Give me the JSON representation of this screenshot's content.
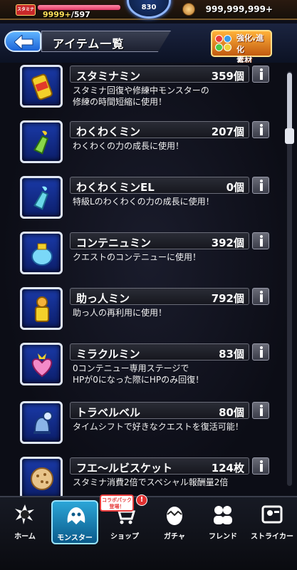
{
  "status": {
    "stamina_label": "スタミナ",
    "stamina_current": "9999+",
    "stamina_max": "/597",
    "stamina_fraction": 1.0,
    "rank": "830",
    "coins": "999,999,999+"
  },
  "header": {
    "title": "アイテム一覧",
    "evolve_button_line1": "強化",
    "evolve_button_v": "v",
    "evolve_button_line1b": "進化",
    "evolve_button_line2": "素材"
  },
  "items": [
    {
      "name": "スタミナミン",
      "count": "359個",
      "desc": "スタミナ回復や修練中モンスターの\n修練の時間短縮に使用！",
      "icon": "stamina-can-icon"
    },
    {
      "name": "わくわくミン",
      "count": "207個",
      "desc": "わくわくの力の成長に使用！",
      "icon": "waku-bottle-icon"
    },
    {
      "name": "わくわくミンEL",
      "count": "0個",
      "desc": "特級Lのわくわくの力の成長に使用！",
      "icon": "waku-el-bottle-icon"
    },
    {
      "name": "コンテニュミン",
      "count": "392個",
      "desc": "クエストのコンテニューに使用！",
      "icon": "continue-jar-icon"
    },
    {
      "name": "助っ人ミン",
      "count": "792個",
      "desc": "助っ人の再利用に使用！",
      "icon": "helper-figure-icon"
    },
    {
      "name": "ミラクルミン",
      "count": "83個",
      "desc": "0コンテニュー専用ステージで\nHPが0になった際にHPのみ回復！",
      "icon": "miracle-heart-icon"
    },
    {
      "name": "トラベルベル",
      "count": "80個",
      "desc": "タイムシフトで好きなクエストを復活可能！",
      "icon": "travel-bell-icon"
    },
    {
      "name": "フエ〜ルビスケット",
      "count": "124枚",
      "desc": "スタミナ消費2倍でスペシャル報酬量2倍",
      "icon": "biscuit-icon"
    }
  ],
  "nav": {
    "home": "ホーム",
    "monster": "モンスター",
    "shop": "ショップ",
    "gacha": "ガチャ",
    "friend": "フレンド",
    "striker": "ストライカー",
    "shop_badge": "コラボパック\n登場！",
    "alert": "!"
  },
  "colors": {
    "accent_blue": "#1c64d8",
    "frame_blue": "#1a3aa8",
    "alert_red": "#e23030",
    "active_tab": "#2ca6d8"
  }
}
